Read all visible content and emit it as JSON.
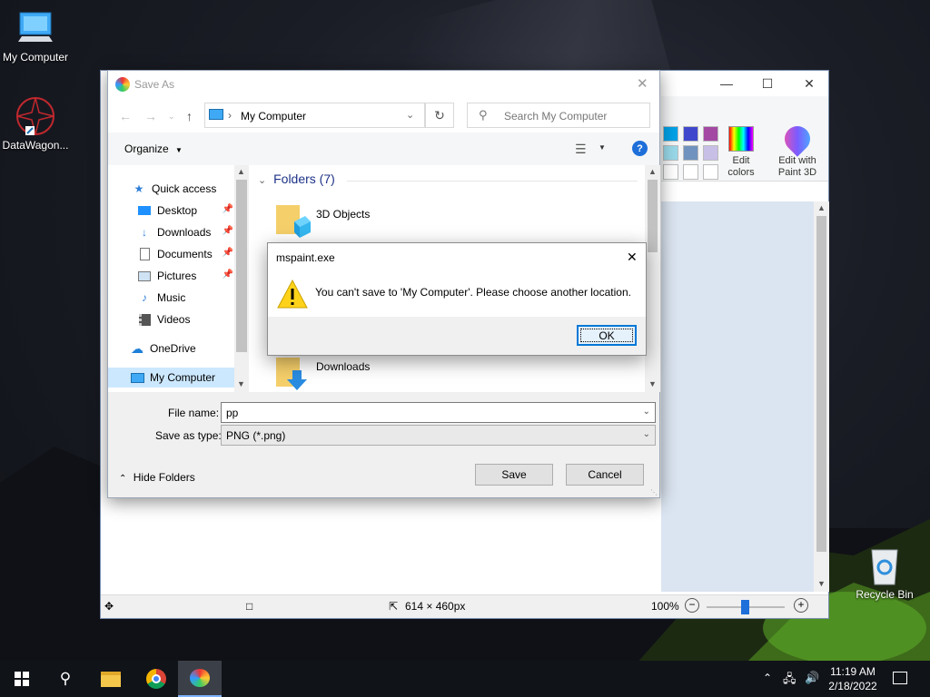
{
  "desktop": {
    "icons": [
      {
        "label": "My Computer"
      },
      {
        "label": "DataWagon..."
      },
      {
        "label": "Recycle Bin"
      }
    ]
  },
  "paint": {
    "ribbon": {
      "edit_colors": "Edit\ncolors",
      "edit_colors_l1": "Edit",
      "edit_colors_l2": "colors",
      "paint3d_l1": "Edit with",
      "paint3d_l2": "Paint 3D"
    },
    "status": {
      "dimensions": "614 × 460px",
      "zoom": "100%"
    },
    "swatch_colors": [
      "#00a2e8",
      "#3f48cc",
      "#a349a4",
      "#99d9ea",
      "#7092be",
      "#c8bfe7",
      "#ffffff",
      "#ffffff",
      "#ffffff"
    ]
  },
  "saveas": {
    "title": "Save As",
    "address": "My Computer",
    "search_placeholder": "Search My Computer",
    "organize": "Organize",
    "nav": {
      "quick_access": "Quick access",
      "desktop": "Desktop",
      "downloads": "Downloads",
      "documents": "Documents",
      "pictures": "Pictures",
      "music": "Music",
      "videos": "Videos",
      "onedrive": "OneDrive",
      "my_computer": "My Computer"
    },
    "folders_header": "Folders (7)",
    "folders": {
      "first": "3D Objects",
      "downloads": "Downloads"
    },
    "file_name_label": "File name:",
    "file_name_value": "pp",
    "save_type_label": "Save as type:",
    "save_type_value": "PNG (*.png)",
    "hide_folders": "Hide Folders",
    "save_button": "Save",
    "cancel_button": "Cancel"
  },
  "message": {
    "title": "mspaint.exe",
    "text": "You can't save to 'My Computer'. Please choose another location.",
    "ok": "OK"
  },
  "taskbar": {
    "time": "11:19 AM",
    "date": "2/18/2022"
  }
}
